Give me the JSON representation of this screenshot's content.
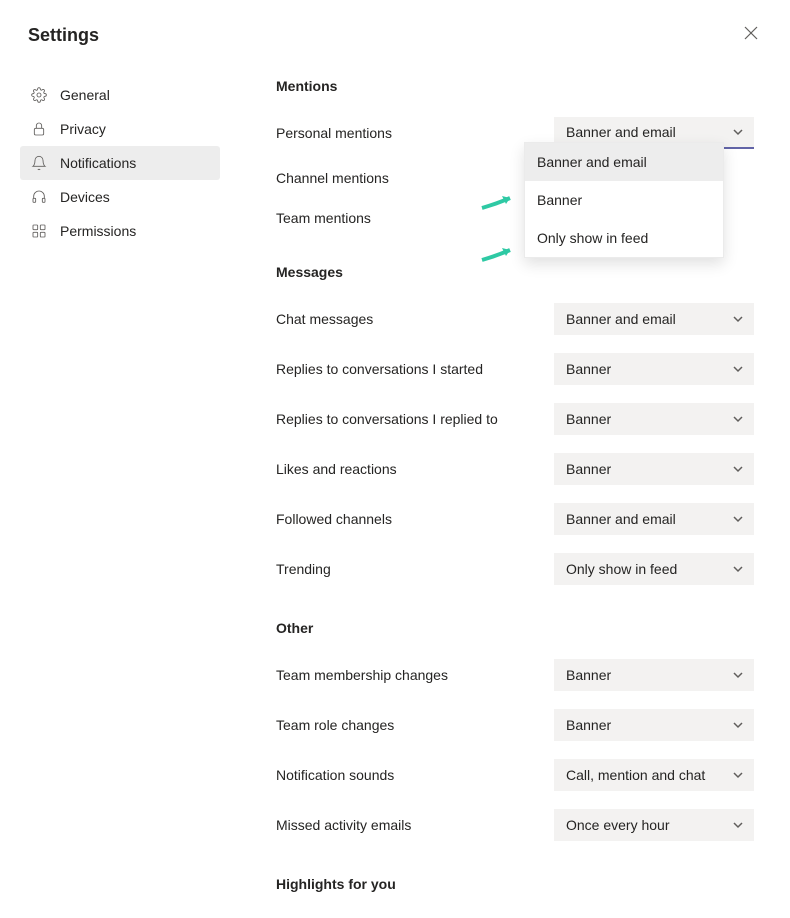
{
  "title": "Settings",
  "sidebar": {
    "items": [
      {
        "label": "General"
      },
      {
        "label": "Privacy"
      },
      {
        "label": "Notifications"
      },
      {
        "label": "Devices"
      },
      {
        "label": "Permissions"
      }
    ]
  },
  "sections": {
    "mentions": {
      "title": "Mentions",
      "personal": {
        "label": "Personal mentions",
        "value": "Banner and email"
      },
      "channel": {
        "label": "Channel mentions"
      },
      "team": {
        "label": "Team mentions"
      }
    },
    "messages": {
      "title": "Messages",
      "chat": {
        "label": "Chat messages",
        "value": "Banner and email"
      },
      "replies_started": {
        "label": "Replies to conversations I started",
        "value": "Banner"
      },
      "replies_replied": {
        "label": "Replies to conversations I replied to",
        "value": "Banner"
      },
      "likes": {
        "label": "Likes and reactions",
        "value": "Banner"
      },
      "followed": {
        "label": "Followed channels",
        "value": "Banner and email"
      },
      "trending": {
        "label": "Trending",
        "value": "Only show in feed"
      }
    },
    "other": {
      "title": "Other",
      "membership": {
        "label": "Team membership changes",
        "value": "Banner"
      },
      "role": {
        "label": "Team role changes",
        "value": "Banner"
      },
      "sounds": {
        "label": "Notification sounds",
        "value": "Call, mention and chat"
      },
      "missed": {
        "label": "Missed activity emails",
        "value": "Once every hour"
      }
    },
    "highlights": {
      "title": "Highlights for you"
    }
  },
  "dropdown_options": [
    "Banner and email",
    "Banner",
    "Only show in feed"
  ],
  "colors": {
    "accent": "#6264a7",
    "arrow": "#2ec9a4"
  }
}
